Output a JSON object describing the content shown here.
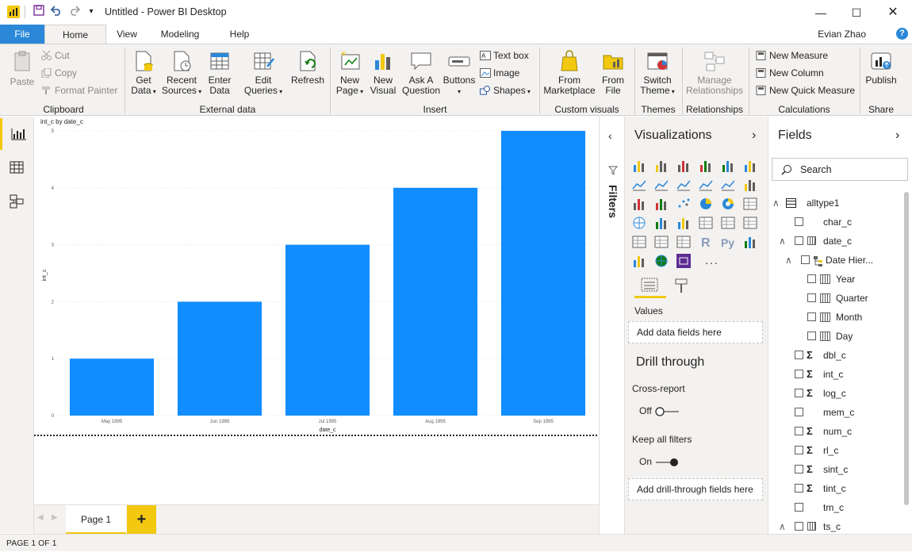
{
  "window": {
    "title": "Untitled - Power BI Desktop",
    "user": "Evian Zhao"
  },
  "menu": {
    "tabs": [
      "File",
      "Home",
      "View",
      "Modeling",
      "Help"
    ]
  },
  "ribbon": {
    "clipboard": {
      "paste": "Paste",
      "cut": "Cut",
      "copy": "Copy",
      "format_painter": "Format Painter",
      "label": "Clipboard"
    },
    "external_data": {
      "get_data": [
        "Get",
        "Data"
      ],
      "recent_sources": [
        "Recent",
        "Sources"
      ],
      "enter_data": [
        "Enter",
        "Data"
      ],
      "edit_queries": [
        "Edit",
        "Queries"
      ],
      "refresh": "Refresh",
      "label": "External data"
    },
    "insert": {
      "new_page": [
        "New",
        "Page"
      ],
      "new_visual": [
        "New",
        "Visual"
      ],
      "ask_question": [
        "Ask A",
        "Question"
      ],
      "buttons": "Buttons",
      "text_box": "Text box",
      "image": "Image",
      "shapes": "Shapes",
      "label": "Insert"
    },
    "custom_visuals": {
      "from_marketplace": [
        "From",
        "Marketplace"
      ],
      "from_file": [
        "From",
        "File"
      ],
      "label": "Custom visuals"
    },
    "themes": {
      "switch_theme": [
        "Switch",
        "Theme"
      ],
      "label": "Themes"
    },
    "relationships": {
      "manage": [
        "Manage",
        "Relationships"
      ],
      "label": "Relationships"
    },
    "calculations": {
      "new_measure": "New Measure",
      "new_column": "New Column",
      "new_quick_measure": "New Quick Measure",
      "label": "Calculations"
    },
    "share": {
      "publish": "Publish",
      "label": "Share"
    }
  },
  "pages": {
    "tab": "Page 1",
    "add": "+",
    "status": "PAGE 1 OF 1"
  },
  "filters": {
    "label": "Filters"
  },
  "visualizations": {
    "title": "Visualizations",
    "values_label": "Values",
    "values_placeholder": "Add data fields here",
    "drill_through_title": "Drill through",
    "cross_report": "Cross-report",
    "cross_report_state": "Off",
    "keep_all_filters": "Keep all filters",
    "keep_all_filters_state": "On",
    "drill_placeholder": "Add drill-through fields here",
    "more": "···"
  },
  "fields": {
    "title": "Fields",
    "search_placeholder": "Search",
    "table": "alltype1",
    "items": [
      {
        "name": "char_c",
        "type": "text"
      },
      {
        "name": "date_c",
        "type": "date"
      },
      {
        "name": "Date Hier...",
        "type": "hierarchy"
      },
      {
        "name": "Year",
        "type": "level"
      },
      {
        "name": "Quarter",
        "type": "level"
      },
      {
        "name": "Month",
        "type": "level"
      },
      {
        "name": "Day",
        "type": "level"
      },
      {
        "name": "dbl_c",
        "type": "sum"
      },
      {
        "name": "int_c",
        "type": "sum"
      },
      {
        "name": "log_c",
        "type": "sum"
      },
      {
        "name": "mem_c",
        "type": "text"
      },
      {
        "name": "num_c",
        "type": "sum"
      },
      {
        "name": "rl_c",
        "type": "sum"
      },
      {
        "name": "sint_c",
        "type": "sum"
      },
      {
        "name": "tint_c",
        "type": "sum"
      },
      {
        "name": "tm_c",
        "type": "text"
      },
      {
        "name": "ts_c",
        "type": "date"
      }
    ]
  },
  "chart_data": {
    "type": "bar",
    "title": "int_c by date_c",
    "xlabel": "date_c",
    "ylabel": "int_c",
    "categories": [
      "May 1995",
      "Jun 1995",
      "Jul 1995",
      "Aug 1995",
      "Sep 1995"
    ],
    "values": [
      1,
      2,
      3,
      4,
      5
    ],
    "ylim": [
      0,
      5
    ],
    "yticks": [
      "0",
      "1",
      "2",
      "3",
      "4",
      "5"
    ],
    "grid": true,
    "bar_color": "#118dff"
  },
  "colors": {
    "accent": "#f2c811",
    "file_tab": "#2b88d8",
    "bar": "#118dff"
  }
}
